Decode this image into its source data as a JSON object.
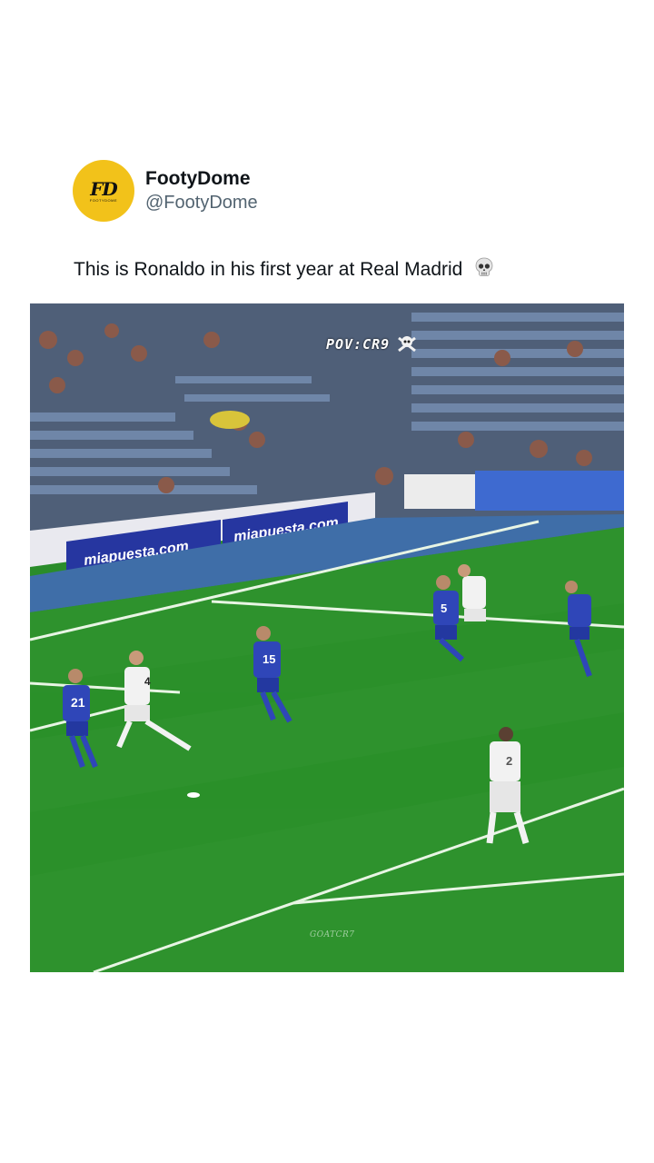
{
  "post": {
    "avatar_logo": "FD",
    "avatar_logo_sub": "FOOTYDOME",
    "display_name": "FootyDome",
    "handle": "@FootyDome",
    "caption": "This is Ronaldo in his first year at Real Madrid",
    "caption_emoji": "skull-icon"
  },
  "media": {
    "overlay_text": "POV:CR9",
    "overlay_icon": "skull-crossbones-icon",
    "watermark": "GOATCR7",
    "ad_boards": [
      "miapuesta.com",
      "miapuesta.com"
    ],
    "players": [
      {
        "team": "white",
        "number": "4"
      },
      {
        "team": "blue",
        "number": "21"
      },
      {
        "team": "blue",
        "number": "15"
      },
      {
        "team": "blue",
        "number": "5"
      },
      {
        "team": "white",
        "number": ""
      },
      {
        "team": "blue",
        "number": ""
      },
      {
        "team": "white",
        "number": "2"
      }
    ]
  },
  "colors": {
    "avatar_bg": "#f2c21a",
    "pitch": "#2e922d",
    "blue_kit": "#2f46b8",
    "white_kit": "#f2f2f2"
  }
}
